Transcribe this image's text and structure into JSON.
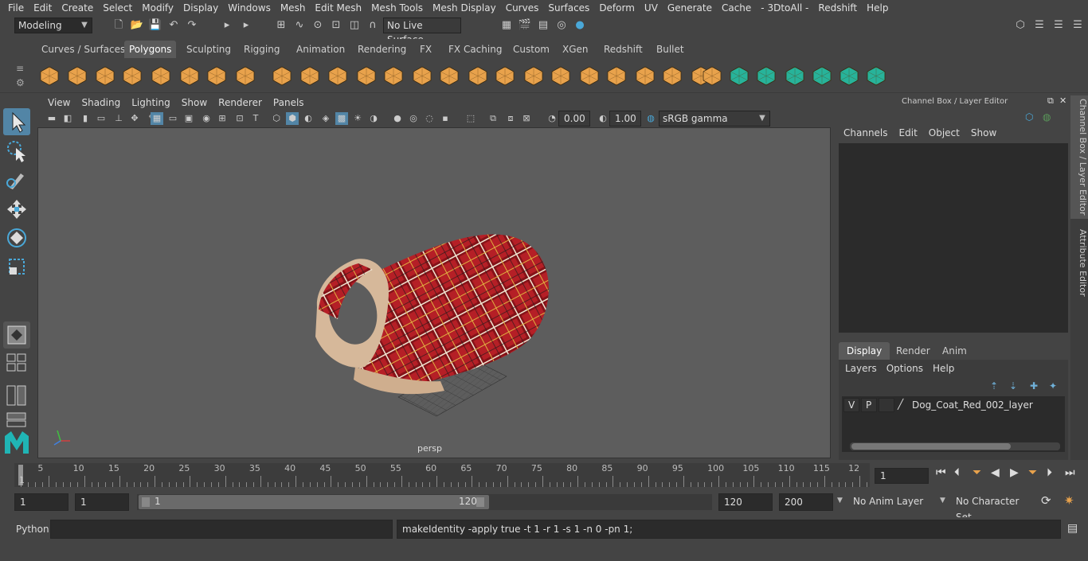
{
  "menubar": [
    "File",
    "Edit",
    "Create",
    "Select",
    "Modify",
    "Display",
    "Windows",
    "Mesh",
    "Edit Mesh",
    "Mesh Tools",
    "Mesh Display",
    "Curves",
    "Surfaces",
    "Deform",
    "UV",
    "Generate",
    "Cache",
    "- 3DtoAll -",
    "Redshift",
    "Help"
  ],
  "status": {
    "mode": "Modeling",
    "live_surface": "No Live Surface"
  },
  "shelf_tabs": [
    "Curves / Surfaces",
    "Polygons",
    "Sculpting",
    "Rigging",
    "Animation",
    "Rendering",
    "FX",
    "FX Caching",
    "Custom",
    "XGen",
    "Redshift",
    "Bullet"
  ],
  "shelf_active": "Polygons",
  "viewport": {
    "menu": [
      "View",
      "Shading",
      "Lighting",
      "Show",
      "Renderer",
      "Panels"
    ],
    "exposure": "0.00",
    "gamma": "1.00",
    "colorspace": "sRGB gamma",
    "camera_label": "persp"
  },
  "channel_box": {
    "title": "Channel Box / Layer Editor",
    "menu": [
      "Channels",
      "Edit",
      "Object",
      "Show"
    ],
    "layer_tabs": [
      "Display",
      "Render",
      "Anim"
    ],
    "layer_tab_active": "Display",
    "layer_menu": [
      "Layers",
      "Options",
      "Help"
    ],
    "layer": {
      "v": "V",
      "p": "P",
      "name": "Dog_Coat_Red_002_layer"
    }
  },
  "side_tabs": [
    "Channel Box / Layer Editor",
    "Attribute Editor"
  ],
  "timeline": {
    "ticks": [
      "1",
      "5",
      "10",
      "15",
      "20",
      "25",
      "30",
      "35",
      "40",
      "45",
      "50",
      "55",
      "60",
      "65",
      "70",
      "75",
      "80",
      "85",
      "90",
      "95",
      "100",
      "105",
      "110",
      "115",
      "12"
    ],
    "current_frame": "1"
  },
  "range": {
    "start": "1",
    "start2": "1",
    "slider_start": "1",
    "slider_end": "120",
    "end": "120",
    "end2": "200",
    "anim_layer": "No Anim Layer",
    "char_set": "No Character Set"
  },
  "cmdline": {
    "lang": "Python",
    "result": "makeIdentity -apply true -t 1 -r 1 -s 1 -n 0 -pn 1;"
  },
  "colors": {
    "accent": "#5285a6",
    "shelf_icon": "#e8a24c",
    "viewport_bg": "#5d5d5d"
  }
}
